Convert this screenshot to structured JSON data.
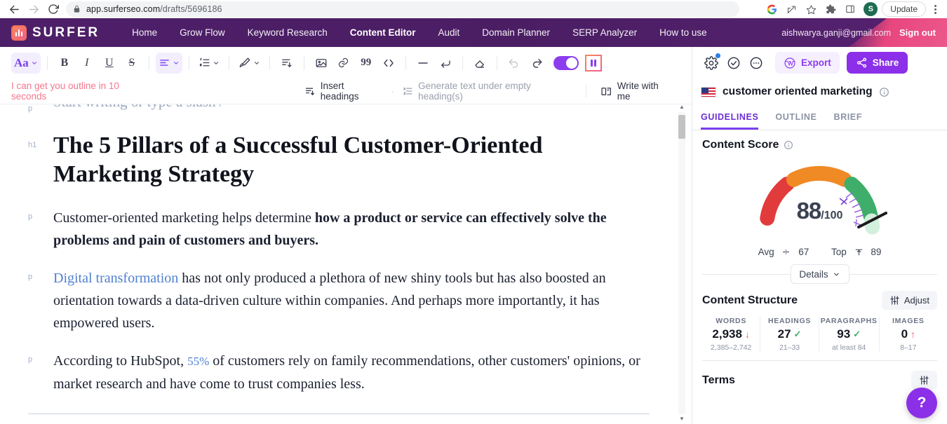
{
  "browser": {
    "url_domain": "app.surferseo.com",
    "url_path": "/drafts/5696186",
    "back_icon": "back-arrow-icon",
    "forward_icon": "forward-arrow-icon",
    "reload_icon": "reload-icon",
    "lock_icon": "lock-icon",
    "google_icon": "google-icon",
    "share_icon": "share-icon",
    "bookmark_icon": "star-icon",
    "extensions_icon": "puzzle-icon",
    "sidepanel_icon": "side-panel-icon",
    "avatar_letter": "S",
    "update_label": "Update",
    "menu_icon": "three-dot-menu-icon"
  },
  "surfer_nav": {
    "logo_text": "SURFER",
    "links": [
      {
        "label": "Home",
        "active": false
      },
      {
        "label": "Grow Flow",
        "active": false
      },
      {
        "label": "Keyword Research",
        "active": false
      },
      {
        "label": "Content Editor",
        "active": true
      },
      {
        "label": "Audit",
        "active": false
      },
      {
        "label": "Domain Planner",
        "active": false
      },
      {
        "label": "SERP Analyzer",
        "active": false
      },
      {
        "label": "How to use",
        "active": false
      }
    ],
    "email": "aishwarya.ganji@gmail.com",
    "sign_out": "Sign out"
  },
  "toolbar": {
    "font_label": "Aa",
    "bold": "B",
    "italic": "I",
    "underline": "U",
    "strikethrough": "S",
    "items": [
      "font-style-dropdown",
      "bold-button",
      "italic-button",
      "underline-button",
      "strikethrough-button",
      "align-dropdown",
      "ordered-list-dropdown",
      "format-brush-dropdown",
      "indent-button",
      "insert-image-button",
      "insert-link-button",
      "blockquote-button",
      "code-block-button",
      "horizontal-rule-button",
      "page-break-button",
      "clear-format-button",
      "undo-button",
      "redo-button",
      "preview-toggle",
      "surfer-ai-button"
    ]
  },
  "ai_bar": {
    "hint": "I can get you outline in 10 seconds",
    "insert_headings": "Insert headings",
    "separator_dot": "·",
    "generate_text": "Generate text under empty heading(s)",
    "write_with_me": "Write with me"
  },
  "document": {
    "placeholder_block": {
      "gutter": "p",
      "text": "Start writing or type a slash /"
    },
    "blocks": [
      {
        "gutter": "h1",
        "type": "h1",
        "text": "The 5 Pillars of a Successful Customer-Oriented Marketing Strategy"
      },
      {
        "gutter": "p",
        "type": "p",
        "lead": "Customer-oriented marketing helps determine ",
        "bold": "how a product or service can effectively solve the problems and pain of customers and buyers.",
        "tail": ""
      },
      {
        "gutter": "p",
        "type": "p-link",
        "link": "Digital transformation",
        "tail": " has not only produced a plethora of new shiny tools but has also boosted an orientation towards a data-driven culture within companies. And perhaps more importantly, it has empowered users."
      },
      {
        "gutter": "p",
        "type": "p-inline-link",
        "lead": "According to HubSpot, ",
        "link": "55%",
        "tail": " of customers rely on family recommendations, other customers' opinions, or market research and have come to trust companies less."
      }
    ]
  },
  "side_panel": {
    "actions": {
      "settings_icon": "gear-icon",
      "check_icon": "check-circle-icon",
      "more_icon": "more-horizontal-icon",
      "export_label": "Export",
      "export_icon": "wordpress-icon",
      "share_label": "Share",
      "share_icon": "share-nodes-icon"
    },
    "keyword": {
      "flag": "us-flag-icon",
      "text": "customer oriented marketing",
      "info_icon": "info-icon"
    },
    "tabs": [
      {
        "label": "GUIDELINES",
        "active": true
      },
      {
        "label": "OUTLINE",
        "active": false
      },
      {
        "label": "BRIEF",
        "active": false
      }
    ],
    "content_score": {
      "title": "Content Score",
      "info_icon": "info-icon",
      "score": "88",
      "denominator": "/100",
      "avg_label": "Avg",
      "avg_value": "67",
      "top_label": "Top",
      "top_value": "89",
      "details_label": "Details",
      "gauge_colors": {
        "low": "#e23b3b",
        "mid": "#f08a24",
        "high": "#3fae6b",
        "rest": "#d3efdd"
      }
    },
    "content_structure": {
      "title": "Content Structure",
      "adjust_label": "Adjust",
      "adjust_icon": "sliders-icon",
      "stats": [
        {
          "label": "WORDS",
          "value": "2,938",
          "marker": "down",
          "range": "2,385–2,742"
        },
        {
          "label": "HEADINGS",
          "value": "27",
          "marker": "check",
          "range": "21–33"
        },
        {
          "label": "PARAGRAPHS",
          "value": "93",
          "marker": "check",
          "range": "at least 84"
        },
        {
          "label": "IMAGES",
          "value": "0",
          "marker": "up",
          "range": "8–17"
        }
      ]
    },
    "terms": {
      "title": "Terms",
      "adjust_icon": "sliders-icon"
    },
    "help_fab": "?"
  }
}
